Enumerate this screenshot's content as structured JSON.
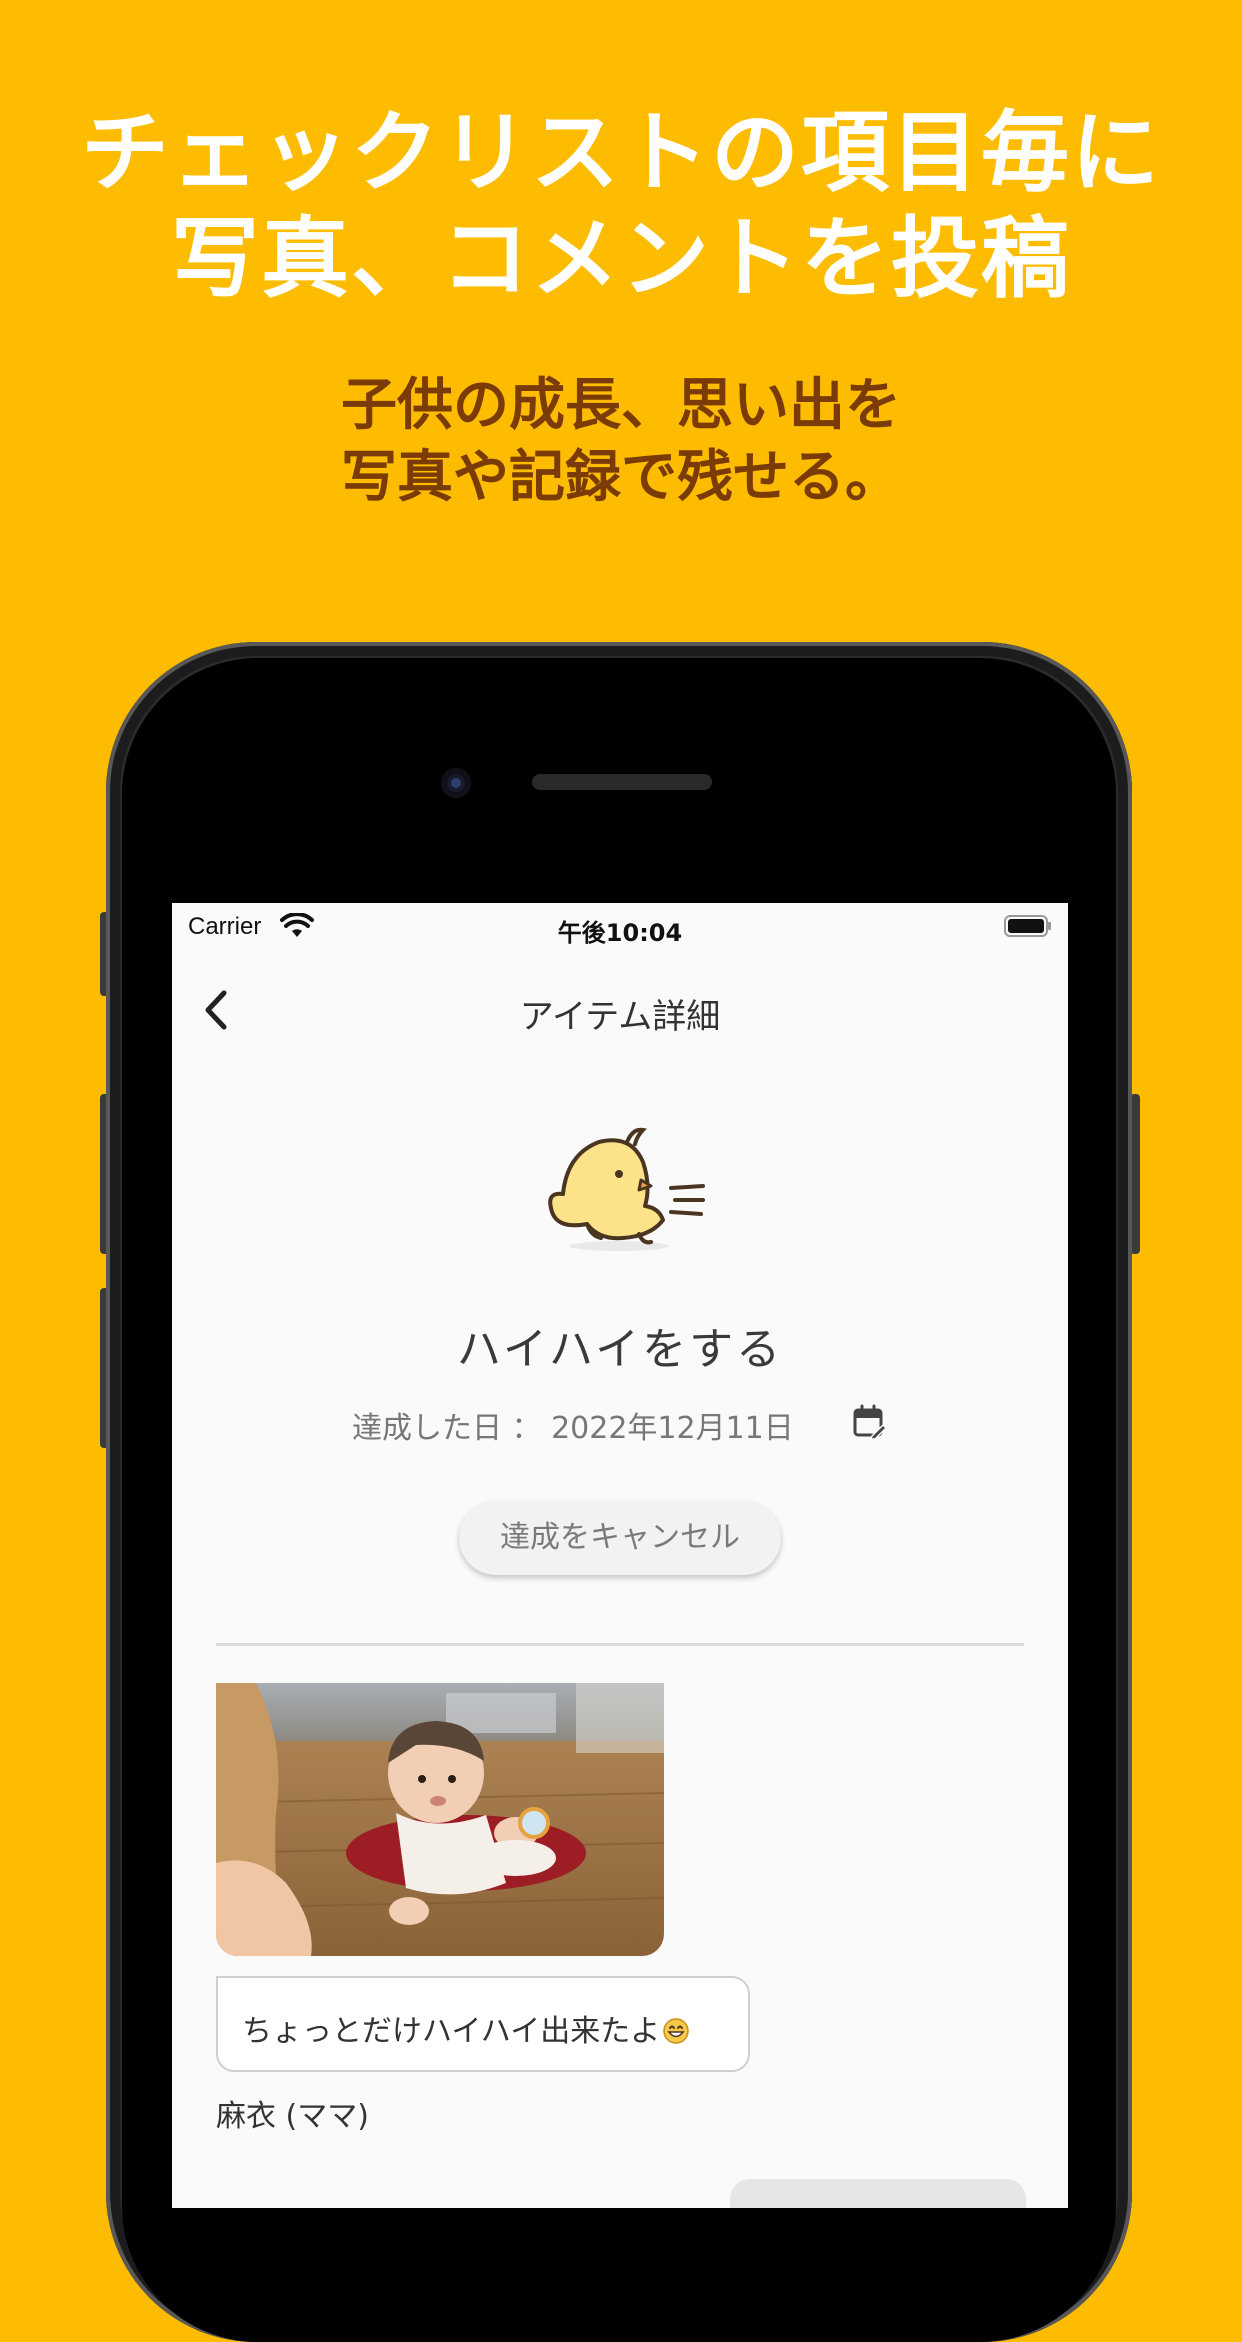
{
  "promo": {
    "headline_line1": "チェックリストの項目毎に",
    "headline_line2": "写真、コメントを投稿",
    "sub_line1": "子供の成長、思い出を",
    "sub_line2": "写真や記録で残せる。"
  },
  "status_bar": {
    "carrier": "Carrier",
    "time": "午後10:04"
  },
  "nav": {
    "title": "アイテム詳細",
    "back_icon": "chevron-left-icon"
  },
  "item": {
    "illustration": "chick-icon",
    "title": "ハイハイをする",
    "achieved_date_label": "達成した日 ： 2022年12月11日",
    "calendar_icon": "calendar-edit-icon",
    "cancel_button_label": "達成をキャンセル"
  },
  "post": {
    "comment": "ちょっとだけハイハイ出来たよ",
    "comment_emoji": "grinning-face-icon",
    "author": "麻衣 (ママ)"
  },
  "colors": {
    "background": "#FDBC00",
    "headline": "#FFFFFF",
    "subheadline": "#7A3B06",
    "chick": "#FCE38A"
  }
}
